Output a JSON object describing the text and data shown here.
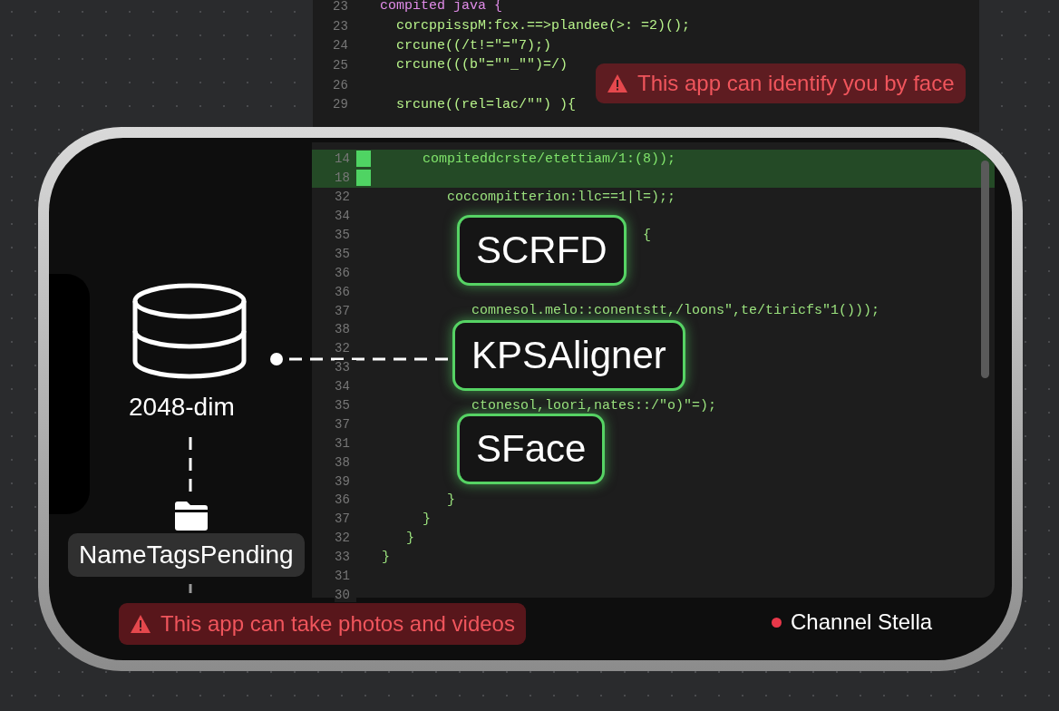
{
  "back_editor": {
    "lines": [
      {
        "number": "23",
        "code": "compited java {"
      },
      {
        "number": "23",
        "code": "  corcppisspM:fcx.==>plandee(>: =2)();"
      },
      {
        "number": "24",
        "code": "  crcune((/t!=\"=\"7);)"
      },
      {
        "number": "25",
        "code": "  crcune(((b\"=\"\"_\"\")=/)"
      },
      {
        "number": "26"
      },
      {
        "number": "29",
        "code": "  srcune((rel=lac/\"\") ){"
      }
    ]
  },
  "face_warning": {
    "text": "This app can identify you by face"
  },
  "editor": {
    "lines": [
      {
        "number": "14",
        "code": "     compiteddcrste/etettiam/1:(8));",
        "highlighted": true
      },
      {
        "number": "18",
        "highlighted": true
      },
      {
        "number": "32",
        "code": "        coccompitterion:llc==1|l=);;",
        "highlighted": false
      },
      {
        "number": "34",
        "highlighted": false
      },
      {
        "number": "35",
        "code": "                                {",
        "highlighted": false
      },
      {
        "number": "35",
        "highlighted": false
      },
      {
        "number": "36",
        "highlighted": false
      },
      {
        "number": "36",
        "highlighted": false
      },
      {
        "number": "37",
        "code": "           comnesol.melo::conentstt,/loons\",te/tiricfs\"1()));",
        "highlighted": false
      },
      {
        "number": "38",
        "highlighted": false
      },
      {
        "number": "32",
        "highlighted": false
      },
      {
        "number": "33",
        "highlighted": false
      },
      {
        "number": "34",
        "highlighted": false
      },
      {
        "number": "35",
        "code": "           ctonesol,loori,nates::/\"o)\"=);",
        "highlighted": false
      },
      {
        "number": "37",
        "highlighted": false
      },
      {
        "number": "31",
        "highlighted": false
      },
      {
        "number": "38",
        "highlighted": false
      },
      {
        "number": "39",
        "highlighted": false
      },
      {
        "number": "36",
        "code": "        }",
        "highlighted": false
      },
      {
        "number": "37",
        "code": "     }",
        "highlighted": false
      },
      {
        "number": "32",
        "code": "   }",
        "highlighted": false
      },
      {
        "number": "33",
        "code": "}",
        "highlighted": false
      },
      {
        "number": "31",
        "highlighted": false
      },
      {
        "number": "30",
        "highlighted": false
      }
    ],
    "stages": [
      "SCRFD",
      "KPSAligner",
      "SFace"
    ]
  },
  "embedding": {
    "label": "2048-dim"
  },
  "folder": {
    "label": "NameTagsPending"
  },
  "camera_warning": {
    "text": "This app can take photos and videos"
  },
  "channel": {
    "name": "Channel Stella",
    "live": true
  }
}
